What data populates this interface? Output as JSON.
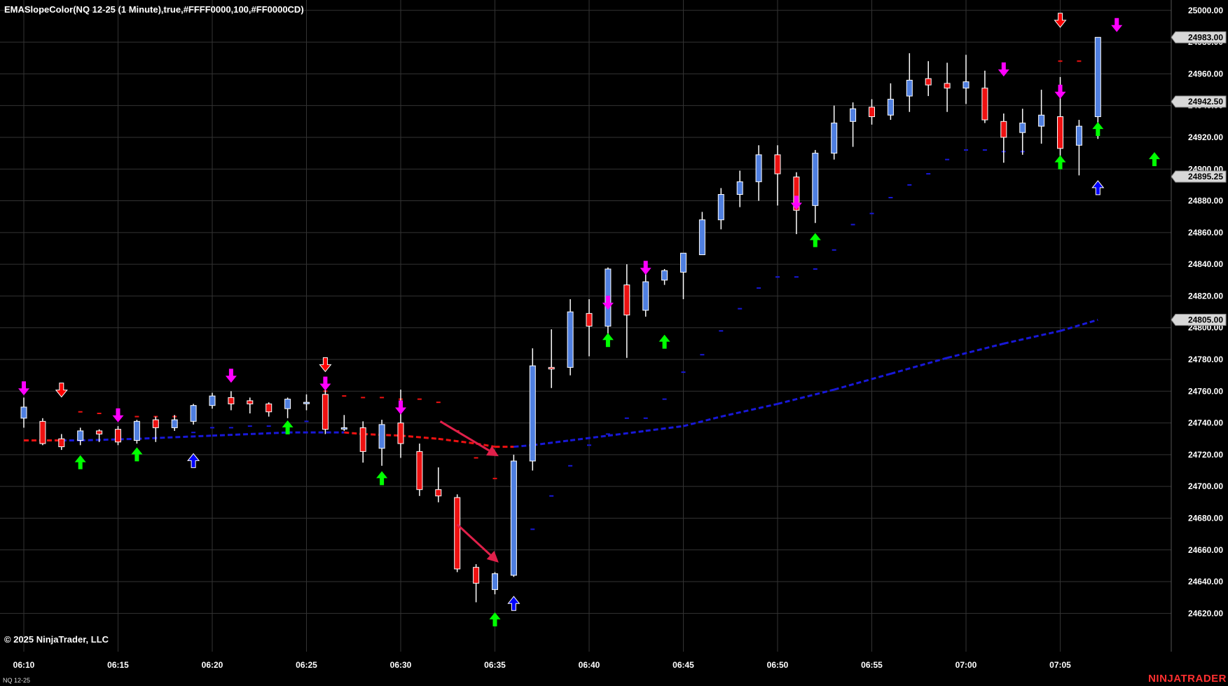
{
  "indicator_label": "EMASlopeColor(NQ 12-25 (1 Minute),true,#FFFF0000,100,#FF0000CD)",
  "copyright": "© 2025 NinjaTrader, LLC",
  "instrument": "NQ 12-25",
  "brand": "NINJATRADER",
  "colors": {
    "up": "#4f7fe0",
    "down": "#ee1111",
    "ema_up": "#1818d8",
    "ema_down": "#ee1111",
    "arrow_green": "#00ff00",
    "arrow_magenta": "#ff00ff",
    "arrow_red": "#ff0000",
    "arrow_blue": "#0000ff",
    "annotation": "#e0204a",
    "grid": "#333333"
  },
  "chart_data": {
    "type": "candlestick",
    "ylim": [
      24610,
      25003
    ],
    "y_ticks": [
      25000,
      24980,
      24960,
      24940,
      24920,
      24900,
      24880,
      24860,
      24840,
      24820,
      24800,
      24780,
      24760,
      24740,
      24720,
      24700,
      24680,
      24660,
      24640,
      24620
    ],
    "y_tick_labels": [
      "25000.00",
      "24980.00",
      "24960.00",
      "24940.00",
      "24920.00",
      "24900.00",
      "24880.00",
      "24860.00",
      "24840.00",
      "24820.00",
      "24800.00",
      "24780.00",
      "24760.00",
      "24740.00",
      "24720.00",
      "24700.00",
      "24680.00",
      "24660.00",
      "24640.00",
      "24620.00"
    ],
    "x_tick_labels": [
      "06:10",
      "06:15",
      "06:20",
      "06:25",
      "06:30",
      "06:35",
      "06:40",
      "06:45",
      "06:50",
      "06:55",
      "07:00",
      "07:05"
    ],
    "x_tick_minutes": [
      10,
      15,
      20,
      25,
      30,
      35,
      40,
      45,
      50,
      55,
      60,
      65
    ],
    "price_tags": [
      {
        "value": 24983.0,
        "label": "24983.00"
      },
      {
        "value": 24942.5,
        "label": "24942.50"
      },
      {
        "value": 24895.25,
        "label": "24895.25"
      },
      {
        "value": 24805.0,
        "label": "24805.00"
      }
    ],
    "candles": [
      {
        "t": 10,
        "o": 24743,
        "h": 24756,
        "l": 24737,
        "c": 24750
      },
      {
        "t": 11,
        "o": 24741,
        "h": 24743,
        "l": 24726,
        "c": 24727
      },
      {
        "t": 12,
        "o": 24730,
        "h": 24733,
        "l": 24723,
        "c": 24725
      },
      {
        "t": 13,
        "o": 24729,
        "h": 24737,
        "l": 24726,
        "c": 24735
      },
      {
        "t": 14,
        "o": 24735,
        "h": 24736,
        "l": 24728,
        "c": 24733
      },
      {
        "t": 15,
        "o": 24736,
        "h": 24738,
        "l": 24726,
        "c": 24728
      },
      {
        "t": 16,
        "o": 24729,
        "h": 24742,
        "l": 24727,
        "c": 24741
      },
      {
        "t": 17,
        "o": 24742,
        "h": 24744,
        "l": 24728,
        "c": 24737
      },
      {
        "t": 18,
        "o": 24737,
        "h": 24745,
        "l": 24735,
        "c": 24742
      },
      {
        "t": 19,
        "o": 24741,
        "h": 24752,
        "l": 24739,
        "c": 24751
      },
      {
        "t": 20,
        "o": 24751,
        "h": 24759,
        "l": 24749,
        "c": 24757
      },
      {
        "t": 21,
        "o": 24756,
        "h": 24760,
        "l": 24748,
        "c": 24752
      },
      {
        "t": 22,
        "o": 24754,
        "h": 24756,
        "l": 24746,
        "c": 24752
      },
      {
        "t": 23,
        "o": 24752,
        "h": 24753,
        "l": 24744,
        "c": 24747
      },
      {
        "t": 24,
        "o": 24749,
        "h": 24756,
        "l": 24743,
        "c": 24755
      },
      {
        "t": 25,
        "o": 24753,
        "h": 24758,
        "l": 24748,
        "c": 24753
      },
      {
        "t": 26,
        "o": 24758,
        "h": 24762,
        "l": 24733,
        "c": 24736
      },
      {
        "t": 27,
        "o": 24737,
        "h": 24745,
        "l": 24735,
        "c": 24737
      },
      {
        "t": 28,
        "o": 24737,
        "h": 24741,
        "l": 24715,
        "c": 24722
      },
      {
        "t": 29,
        "o": 24724,
        "h": 24742,
        "l": 24713,
        "c": 24739
      },
      {
        "t": 30,
        "o": 24740,
        "h": 24761,
        "l": 24718,
        "c": 24727
      },
      {
        "t": 31,
        "o": 24722,
        "h": 24727,
        "l": 24694,
        "c": 24698
      },
      {
        "t": 32,
        "o": 24698,
        "h": 24712,
        "l": 24690,
        "c": 24694
      },
      {
        "t": 33,
        "o": 24693,
        "h": 24695,
        "l": 24646,
        "c": 24648
      },
      {
        "t": 34,
        "o": 24649,
        "h": 24651,
        "l": 24627,
        "c": 24639
      },
      {
        "t": 35,
        "o": 24635,
        "h": 24646,
        "l": 24632,
        "c": 24645
      },
      {
        "t": 36,
        "o": 24644,
        "h": 24720,
        "l": 24643,
        "c": 24716
      },
      {
        "t": 37,
        "o": 24716,
        "h": 24787,
        "l": 24710,
        "c": 24776
      },
      {
        "t": 38,
        "o": 24775,
        "h": 24799,
        "l": 24762,
        "c": 24774
      },
      {
        "t": 39,
        "o": 24775,
        "h": 24818,
        "l": 24770,
        "c": 24810
      },
      {
        "t": 40,
        "o": 24809,
        "h": 24818,
        "l": 24782,
        "c": 24801
      },
      {
        "t": 41,
        "o": 24801,
        "h": 24838,
        "l": 24795,
        "c": 24837
      },
      {
        "t": 42,
        "o": 24827,
        "h": 24840,
        "l": 24781,
        "c": 24808
      },
      {
        "t": 43,
        "o": 24811,
        "h": 24840,
        "l": 24807,
        "c": 24829
      },
      {
        "t": 44,
        "o": 24830,
        "h": 24837,
        "l": 24827,
        "c": 24836
      },
      {
        "t": 45,
        "o": 24835,
        "h": 24846,
        "l": 24818,
        "c": 24847
      },
      {
        "t": 46,
        "o": 24846,
        "h": 24873,
        "l": 24846,
        "c": 24868
      },
      {
        "t": 47,
        "o": 24868,
        "h": 24888,
        "l": 24862,
        "c": 24884
      },
      {
        "t": 48,
        "o": 24884,
        "h": 24899,
        "l": 24876,
        "c": 24892
      },
      {
        "t": 49,
        "o": 24892,
        "h": 24915,
        "l": 24880,
        "c": 24909
      },
      {
        "t": 50,
        "o": 24909,
        "h": 24915,
        "l": 24877,
        "c": 24897
      },
      {
        "t": 51,
        "o": 24895,
        "h": 24898,
        "l": 24859,
        "c": 24874
      },
      {
        "t": 52,
        "o": 24877,
        "h": 24912,
        "l": 24866,
        "c": 24910
      },
      {
        "t": 53,
        "o": 24910,
        "h": 24940,
        "l": 24906,
        "c": 24929
      },
      {
        "t": 54,
        "o": 24930,
        "h": 24942,
        "l": 24914,
        "c": 24938
      },
      {
        "t": 55,
        "o": 24939,
        "h": 24944,
        "l": 24928,
        "c": 24933
      },
      {
        "t": 56,
        "o": 24934,
        "h": 24954,
        "l": 24931,
        "c": 24944
      },
      {
        "t": 57,
        "o": 24946,
        "h": 24973,
        "l": 24936,
        "c": 24956
      },
      {
        "t": 58,
        "o": 24957,
        "h": 24968,
        "l": 24946,
        "c": 24953
      },
      {
        "t": 59,
        "o": 24954,
        "h": 24967,
        "l": 24936,
        "c": 24951
      },
      {
        "t": 60,
        "o": 24951,
        "h": 24972,
        "l": 24941,
        "c": 24955
      },
      {
        "t": 61,
        "o": 24951,
        "h": 24962,
        "l": 24929,
        "c": 24931
      },
      {
        "t": 62,
        "o": 24930,
        "h": 24935,
        "l": 24904,
        "c": 24920
      },
      {
        "t": 63,
        "o": 24923,
        "h": 24938,
        "l": 24909,
        "c": 24929
      },
      {
        "t": 64,
        "o": 24927,
        "h": 24950,
        "l": 24916,
        "c": 24934
      },
      {
        "t": 65,
        "o": 24933,
        "h": 24958,
        "l": 24904,
        "c": 24913
      },
      {
        "t": 66,
        "o": 24915,
        "h": 24931,
        "l": 24896,
        "c": 24927
      },
      {
        "t": 67,
        "o": 24933,
        "h": 24983,
        "l": 24919,
        "c": 24983
      }
    ],
    "ema": [
      {
        "t": 10,
        "v": 24729,
        "trend": "down"
      },
      {
        "t": 12,
        "v": 24729,
        "trend": "down"
      },
      {
        "t": 13,
        "v": 24729,
        "trend": "up"
      },
      {
        "t": 16,
        "v": 24730,
        "trend": "up"
      },
      {
        "t": 20,
        "v": 24732,
        "trend": "up"
      },
      {
        "t": 24,
        "v": 24734,
        "trend": "up"
      },
      {
        "t": 27,
        "v": 24734,
        "trend": "up"
      },
      {
        "t": 28,
        "v": 24733,
        "trend": "down"
      },
      {
        "t": 30,
        "v": 24732,
        "trend": "down"
      },
      {
        "t": 32,
        "v": 24730,
        "trend": "down"
      },
      {
        "t": 34,
        "v": 24727,
        "trend": "down"
      },
      {
        "t": 35,
        "v": 24725,
        "trend": "down"
      },
      {
        "t": 36,
        "v": 24725,
        "trend": "down"
      },
      {
        "t": 37,
        "v": 24726,
        "trend": "up"
      },
      {
        "t": 39,
        "v": 24729,
        "trend": "up"
      },
      {
        "t": 41,
        "v": 24732,
        "trend": "up"
      },
      {
        "t": 43,
        "v": 24735,
        "trend": "up"
      },
      {
        "t": 45,
        "v": 24738,
        "trend": "up"
      },
      {
        "t": 47,
        "v": 24744,
        "trend": "up"
      },
      {
        "t": 50,
        "v": 24752,
        "trend": "up"
      },
      {
        "t": 53,
        "v": 24761,
        "trend": "up"
      },
      {
        "t": 56,
        "v": 24771,
        "trend": "up"
      },
      {
        "t": 59,
        "v": 24781,
        "trend": "up"
      },
      {
        "t": 62,
        "v": 24790,
        "trend": "up"
      },
      {
        "t": 65,
        "v": 24798,
        "trend": "up"
      },
      {
        "t": 67,
        "v": 24805,
        "trend": "up"
      }
    ],
    "stops": [
      {
        "t": 13,
        "v": 24747,
        "trend": "down"
      },
      {
        "t": 14,
        "v": 24746,
        "trend": "down"
      },
      {
        "t": 15,
        "v": 24744,
        "trend": "down"
      },
      {
        "t": 16,
        "v": 24744,
        "trend": "down"
      },
      {
        "t": 17,
        "v": 24744,
        "trend": "down"
      },
      {
        "t": 18,
        "v": 24744,
        "trend": "down"
      },
      {
        "t": 19,
        "v": 24734,
        "trend": "up"
      },
      {
        "t": 20,
        "v": 24737,
        "trend": "up"
      },
      {
        "t": 21,
        "v": 24737,
        "trend": "up"
      },
      {
        "t": 22,
        "v": 24738,
        "trend": "up"
      },
      {
        "t": 23,
        "v": 24738,
        "trend": "up"
      },
      {
        "t": 24,
        "v": 24739,
        "trend": "up"
      },
      {
        "t": 25,
        "v": 24741,
        "trend": "up"
      },
      {
        "t": 26,
        "v": 24760,
        "trend": "down"
      },
      {
        "t": 27,
        "v": 24757,
        "trend": "down"
      },
      {
        "t": 28,
        "v": 24756,
        "trend": "down"
      },
      {
        "t": 29,
        "v": 24756,
        "trend": "down"
      },
      {
        "t": 30,
        "v": 24755,
        "trend": "down"
      },
      {
        "t": 31,
        "v": 24755,
        "trend": "down"
      },
      {
        "t": 32,
        "v": 24753,
        "trend": "down"
      },
      {
        "t": 33,
        "v": 24735,
        "trend": "down"
      },
      {
        "t": 34,
        "v": 24718,
        "trend": "down"
      },
      {
        "t": 35,
        "v": 24705,
        "trend": "down"
      },
      {
        "t": 36,
        "v": 24649,
        "trend": "up"
      },
      {
        "t": 37,
        "v": 24673,
        "trend": "up"
      },
      {
        "t": 38,
        "v": 24694,
        "trend": "up"
      },
      {
        "t": 39,
        "v": 24713,
        "trend": "up"
      },
      {
        "t": 40,
        "v": 24726,
        "trend": "up"
      },
      {
        "t": 41,
        "v": 24733,
        "trend": "up"
      },
      {
        "t": 42,
        "v": 24743,
        "trend": "up"
      },
      {
        "t": 43,
        "v": 24743,
        "trend": "up"
      },
      {
        "t": 44,
        "v": 24755,
        "trend": "up"
      },
      {
        "t": 45,
        "v": 24772,
        "trend": "up"
      },
      {
        "t": 46,
        "v": 24783,
        "trend": "up"
      },
      {
        "t": 47,
        "v": 24798,
        "trend": "up"
      },
      {
        "t": 48,
        "v": 24812,
        "trend": "up"
      },
      {
        "t": 49,
        "v": 24825,
        "trend": "up"
      },
      {
        "t": 50,
        "v": 24832,
        "trend": "up"
      },
      {
        "t": 51,
        "v": 24832,
        "trend": "up"
      },
      {
        "t": 52,
        "v": 24837,
        "trend": "up"
      },
      {
        "t": 53,
        "v": 24849,
        "trend": "up"
      },
      {
        "t": 54,
        "v": 24865,
        "trend": "up"
      },
      {
        "t": 55,
        "v": 24872,
        "trend": "up"
      },
      {
        "t": 56,
        "v": 24882,
        "trend": "up"
      },
      {
        "t": 57,
        "v": 24890,
        "trend": "up"
      },
      {
        "t": 58,
        "v": 24897,
        "trend": "up"
      },
      {
        "t": 59,
        "v": 24906,
        "trend": "up"
      },
      {
        "t": 60,
        "v": 24912,
        "trend": "up"
      },
      {
        "t": 61,
        "v": 24912,
        "trend": "up"
      },
      {
        "t": 62,
        "v": 24911,
        "trend": "up"
      },
      {
        "t": 63,
        "v": 24911,
        "trend": "up"
      },
      {
        "t": 65,
        "v": 24968,
        "trend": "down"
      },
      {
        "t": 66,
        "v": 24968,
        "trend": "down"
      }
    ],
    "signal_arrows": [
      {
        "t": 10,
        "v": 24760,
        "dir": "down",
        "color": "magenta"
      },
      {
        "t": 12,
        "v": 24759,
        "dir": "down",
        "color": "red"
      },
      {
        "t": 13,
        "v": 24717,
        "dir": "up",
        "color": "green"
      },
      {
        "t": 15,
        "v": 24743,
        "dir": "down",
        "color": "magenta"
      },
      {
        "t": 16,
        "v": 24722,
        "dir": "up",
        "color": "green"
      },
      {
        "t": 19,
        "v": 24718,
        "dir": "up",
        "color": "blue"
      },
      {
        "t": 21,
        "v": 24768,
        "dir": "down",
        "color": "magenta"
      },
      {
        "t": 24,
        "v": 24739,
        "dir": "up",
        "color": "green"
      },
      {
        "t": 26,
        "v": 24775,
        "dir": "down",
        "color": "red"
      },
      {
        "t": 26,
        "v": 24763,
        "dir": "down",
        "color": "magenta"
      },
      {
        "t": 29,
        "v": 24707,
        "dir": "up",
        "color": "green"
      },
      {
        "t": 30,
        "v": 24748,
        "dir": "down",
        "color": "magenta"
      },
      {
        "t": 35,
        "v": 24618,
        "dir": "up",
        "color": "green"
      },
      {
        "t": 36,
        "v": 24628,
        "dir": "up",
        "color": "blue"
      },
      {
        "t": 41,
        "v": 24814,
        "dir": "down",
        "color": "magenta"
      },
      {
        "t": 41,
        "v": 24794,
        "dir": "up",
        "color": "green"
      },
      {
        "t": 43,
        "v": 24836,
        "dir": "down",
        "color": "magenta"
      },
      {
        "t": 44,
        "v": 24793,
        "dir": "up",
        "color": "green"
      },
      {
        "t": 51,
        "v": 24877,
        "dir": "down",
        "color": "magenta"
      },
      {
        "t": 52,
        "v": 24857,
        "dir": "up",
        "color": "green"
      },
      {
        "t": 62,
        "v": 24961,
        "dir": "down",
        "color": "magenta"
      },
      {
        "t": 65,
        "v": 24992,
        "dir": "down",
        "color": "red"
      },
      {
        "t": 65,
        "v": 24947,
        "dir": "down",
        "color": "magenta"
      },
      {
        "t": 65,
        "v": 24906,
        "dir": "up",
        "color": "green"
      },
      {
        "t": 67,
        "v": 24927,
        "dir": "up",
        "color": "green"
      },
      {
        "t": 67,
        "v": 24890,
        "dir": "up",
        "color": "blue"
      },
      {
        "t": 68,
        "v": 24989,
        "dir": "down",
        "color": "magenta"
      },
      {
        "t": 70,
        "v": 24908,
        "dir": "up",
        "color": "green"
      }
    ],
    "annotations": [
      {
        "type": "arrow",
        "t1": 32.1,
        "v1": 24741,
        "t2": 35.2,
        "v2": 24719
      },
      {
        "type": "arrow",
        "t1": 33.0,
        "v1": 24676,
        "t2": 35.2,
        "v2": 24652
      }
    ]
  }
}
